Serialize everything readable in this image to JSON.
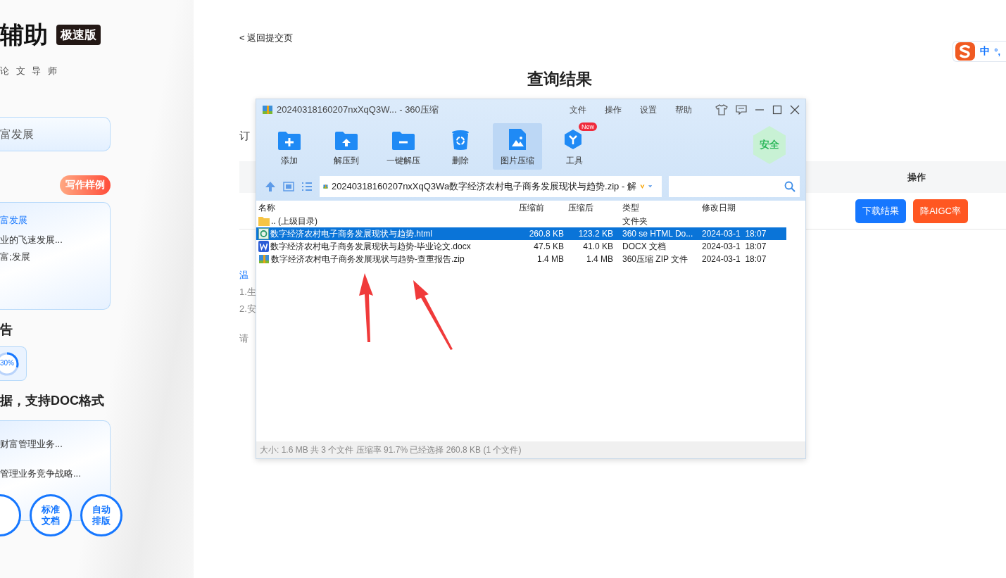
{
  "left_panel": {
    "title": "辅助",
    "edition_badge": "极速版",
    "subtitle": "论 文 导 师",
    "topic_input": "富发展",
    "sample_badge": "写作样例",
    "sample_card": {
      "link": "富发展",
      "lines": [
        "业的飞速发展...",
        "富;发展"
      ]
    },
    "report_heading": "告",
    "rate": {
      "text": "30%",
      "level": 0.3
    },
    "format_heading": "据，支持DOC格式",
    "doc_card": {
      "lines": [
        "财富管理业务...",
        "管理业务竞争战略..."
      ]
    },
    "features": [
      {
        "kind": "cut"
      },
      {
        "kind": "text",
        "label": "标准文档"
      },
      {
        "kind": "text",
        "label": "自动排版"
      }
    ]
  },
  "page": {
    "back_link": "< 返回提交页",
    "title": "查询结果",
    "order_label": "订",
    "table_header": "操作",
    "buttons": [
      {
        "label": "下载结果",
        "kind": "primary"
      },
      {
        "label": "降AIGC率",
        "kind": "warn"
      }
    ],
    "notes": [
      {
        "text": "温",
        "kind": "link"
      },
      {
        "text": "1.生",
        "kind": "plain"
      },
      {
        "text": "2.安",
        "kind": "plain"
      },
      {
        "text": "请",
        "kind": "plain"
      }
    ]
  },
  "ime": {
    "mode": "中",
    "punct": "°,"
  },
  "window": {
    "title": "20240318160207nxXqQ3W... - 360压缩",
    "menu": [
      "文件",
      "操作",
      "设置",
      "帮助"
    ],
    "toolbar": [
      {
        "label": "添加",
        "kind": "add",
        "selected": false
      },
      {
        "label": "解压到",
        "kind": "extract",
        "selected": false
      },
      {
        "label": "一键解压",
        "kind": "quick",
        "selected": false
      },
      {
        "label": "删除",
        "kind": "delete",
        "selected": false
      },
      {
        "label": "图片压缩",
        "kind": "image",
        "selected": true
      },
      {
        "label": "工具",
        "kind": "tools",
        "selected": false,
        "badge": "New"
      }
    ],
    "safe_badge": "安全",
    "path": "20240318160207nxXqQ3Wa数字经济农村电子商务发展现状与趋势.zip - 解",
    "columns": [
      "名称",
      "压缩前",
      "压缩后",
      "类型",
      "修改日期"
    ],
    "rows": [
      {
        "kind": "folder",
        "name": ".. (上级目录)",
        "before": "",
        "after": "",
        "type": "文件夹",
        "date": "",
        "selected": false
      },
      {
        "kind": "html",
        "name": "数字经济农村电子商务发展现状与趋势.html",
        "before": "260.8 KB",
        "after": "123.2 KB",
        "type": "360 se HTML Do...",
        "date": "2024-03-1  18:07",
        "selected": true
      },
      {
        "kind": "docx",
        "name": "数字经济农村电子商务发展现状与趋势-毕业论文.docx",
        "before": "47.5 KB",
        "after": "41.0 KB",
        "type": "DOCX 文档",
        "date": "2024-03-1  18:07",
        "selected": false
      },
      {
        "kind": "zip",
        "name": "数字经济农村电子商务发展现状与趋势-查重报告.zip",
        "before": "1.4 MB",
        "after": "1.4 MB",
        "type": "360压缩 ZIP 文件",
        "date": "2024-03-1  18:07",
        "selected": false
      }
    ],
    "status": "大小: 1.6 MB 共 3 个文件 压缩率 91.7% 已经选择 260.8 KB (1 个文件)"
  }
}
